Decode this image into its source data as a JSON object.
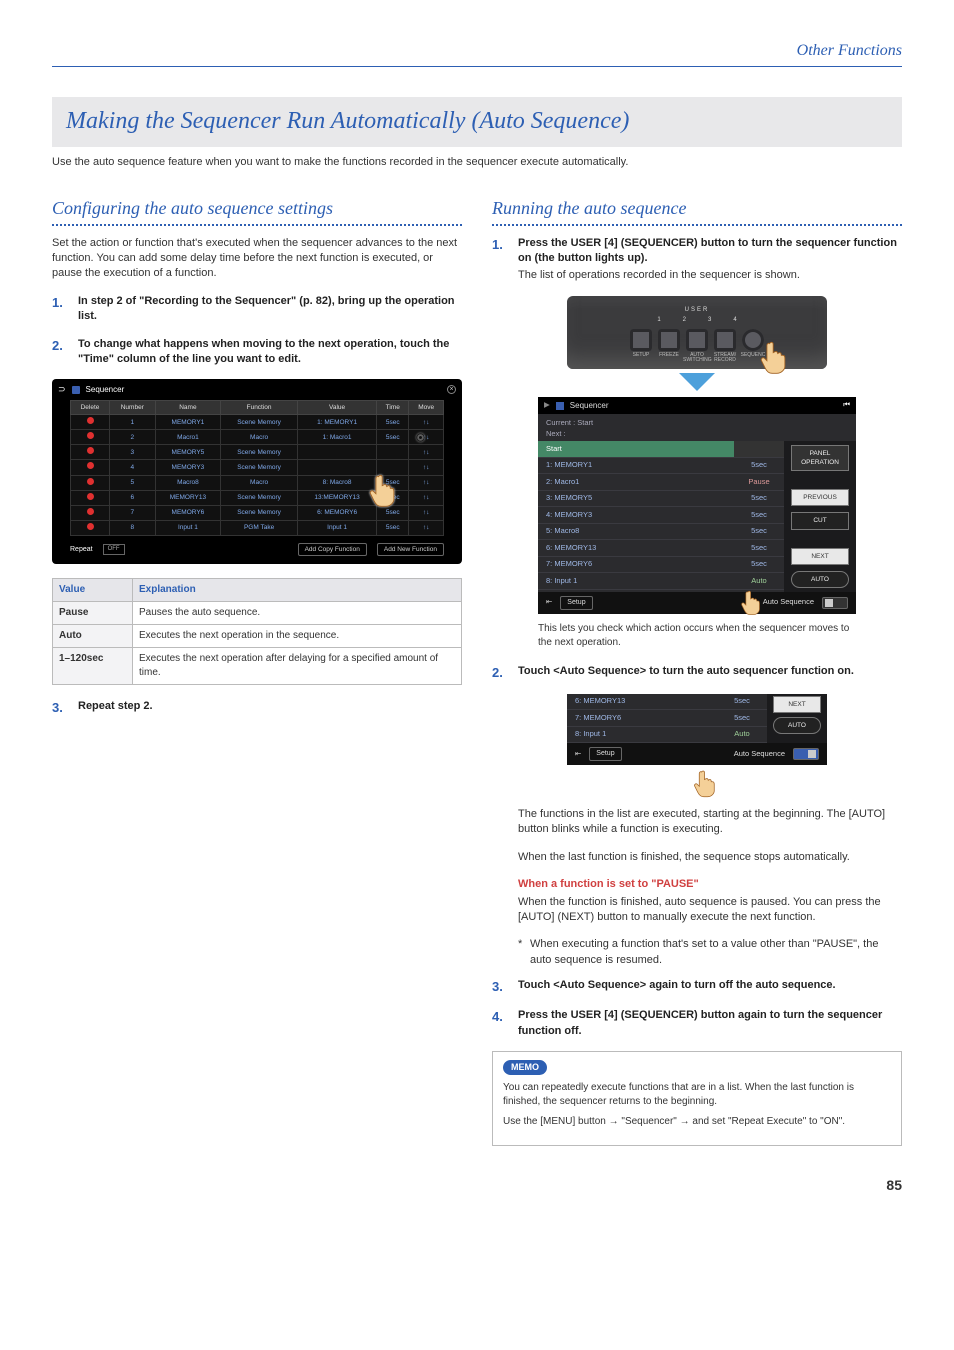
{
  "header": {
    "section": "Other Functions"
  },
  "title": "Making the Sequencer Run Automatically (Auto Sequence)",
  "intro": "Use the auto sequence feature when you want to make the functions recorded in the sequencer execute automatically.",
  "left": {
    "heading": "Configuring the auto sequence settings",
    "lead": "Set the action or function that's executed when the sequencer advances to the next function. You can add some delay time before the next function is executed, or pause the execution of a function.",
    "step1": "In step 2 of \"Recording to the Sequencer\" (p. 82), bring up the operation list.",
    "step2": "To change what happens when moving to the next operation, touch the \"Time\" column of the line you want to edit.",
    "step3": "Repeat step 2.",
    "editor": {
      "title": "Sequencer",
      "cols": [
        "Delete",
        "Number",
        "Name",
        "Function",
        "Value",
        "Time",
        "Move"
      ],
      "rows": [
        {
          "num": "1",
          "name": "MEMORY1",
          "func": "Scene Memory",
          "val": "1: MEMORY1",
          "time": "5sec"
        },
        {
          "num": "2",
          "name": "Macro1",
          "func": "Macro",
          "val": "1: Macro1",
          "time": "5sec"
        },
        {
          "num": "3",
          "name": "MEMORY5",
          "func": "Scene Memory",
          "val": "",
          "time": ""
        },
        {
          "num": "4",
          "name": "MEMORY3",
          "func": "Scene Memory",
          "val": "",
          "time": ""
        },
        {
          "num": "5",
          "name": "Macro8",
          "func": "Macro",
          "val": "8: Macro8",
          "time": "5sec"
        },
        {
          "num": "6",
          "name": "MEMORY13",
          "func": "Scene Memory",
          "val": "13:MEMORY13",
          "time": "5sec"
        },
        {
          "num": "7",
          "name": "MEMORY6",
          "func": "Scene Memory",
          "val": "6: MEMORY6",
          "time": "5sec"
        },
        {
          "num": "8",
          "name": "Input 1",
          "func": "PGM Take",
          "val": "Input 1",
          "time": "5sec"
        }
      ],
      "repeat_label": "Repeat",
      "repeat_value": "OFF",
      "btn_copy": "Add Copy Function",
      "btn_new": "Add New Function"
    },
    "valtable": {
      "h1": "Value",
      "h2": "Explanation",
      "rows": [
        {
          "v": "Pause",
          "e": "Pauses the auto sequence."
        },
        {
          "v": "Auto",
          "e": "Executes the next operation in the sequence."
        },
        {
          "v": "1–120sec",
          "e": "Executes the next operation after delaying for a specified amount of time."
        }
      ]
    }
  },
  "right": {
    "heading": "Running the auto sequence",
    "step1_a": "Press the USER [4] (SEQUENCER) button to turn the sequencer function on (the button lights up).",
    "step1_b": "The list of operations recorded in the sequencer is shown.",
    "hw": {
      "label": "USER",
      "nums": [
        "1",
        "2",
        "3",
        "4"
      ],
      "sublabels": [
        "SETUP",
        "FREEZE",
        "AUTO SWITCHING",
        "STREAM/ RECORD",
        "SEQUENC"
      ]
    },
    "run": {
      "title": "Sequencer",
      "current": "Current : Start",
      "next": "Next     :",
      "panel_op": "PANEL OPERATION",
      "start": "Start",
      "rows": [
        {
          "n": "1: MEMORY1",
          "t": "5sec"
        },
        {
          "n": "2: Macro1",
          "t": "Pause",
          "cls": "pause"
        },
        {
          "n": "3: MEMORY5",
          "t": "5sec"
        },
        {
          "n": "4: MEMORY3",
          "t": "5sec"
        },
        {
          "n": "5: Macro8",
          "t": "5sec"
        },
        {
          "n": "6: MEMORY13",
          "t": "5sec"
        },
        {
          "n": "7: MEMORY6",
          "t": "5sec"
        },
        {
          "n": "8: Input 1",
          "t": "Auto",
          "cls": "auto"
        }
      ],
      "side": {
        "prev": "PREVIOUS",
        "cut": "CUT",
        "next": "NEXT",
        "auto": "AUTO"
      },
      "setup": "Setup",
      "auto_label": "Auto Sequence"
    },
    "caption1": "This lets you check which action occurs when the sequencer moves to the next operation.",
    "step2": "Touch <Auto Sequence> to turn the auto sequencer function on.",
    "mini_rows": [
      {
        "n": "6: MEMORY13",
        "t": "5sec"
      },
      {
        "n": "7: MEMORY6",
        "t": "5sec"
      },
      {
        "n": "8: Input 1",
        "t": "Auto",
        "cls": "auto"
      }
    ],
    "post2_a": "The functions in the list are executed, starting at the beginning. The [AUTO] button blinks while a function is executing.",
    "post2_b": "When the last function is finished, the sequence stops automatically.",
    "pause_head": "When a function is set to \"PAUSE\"",
    "pause_body": "When the function is finished, auto sequence is paused. You can press the [AUTO] (NEXT) button to manually execute the next function.",
    "pause_star": "When executing a function that's set to a value other than \"PAUSE\", the auto sequence is resumed.",
    "step3": "Touch <Auto Sequence> again to turn off the auto sequence.",
    "step4": "Press the USER [4] (SEQUENCER) button again to turn the sequencer function off.",
    "memo": {
      "tag": "MEMO",
      "p1": "You can repeatedly execute functions that are in a list. When the last function is finished, the sequencer returns to the beginning.",
      "p2a": "Use the [MENU] button",
      "p2b": "\"Sequencer\"",
      "p2c": "and set \"Repeat Execute\" to \"ON\"."
    }
  },
  "page_number": "85"
}
